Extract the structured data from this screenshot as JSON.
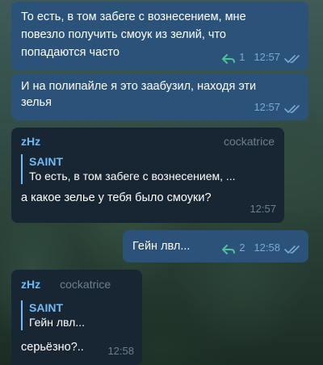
{
  "messages": [
    {
      "text": "То есть, в том забеге с вознесением, мне повезло получить смоук из зелий, что попадаются часто",
      "replies": "1",
      "time": "12:57"
    },
    {
      "text": "И на полипайле я это заабузил, находя эти зелья",
      "time": "12:57"
    },
    {
      "sender": "zHz",
      "tag": "cockatrice",
      "quote_author": "SAINT",
      "quote_text": "То есть, в том забеге с вознесением, ...",
      "text": "а какое зелье у тебя было смоуки?",
      "time": "12:57"
    },
    {
      "text": "Гейн лвл...",
      "replies": "2",
      "time": "12:58"
    },
    {
      "sender": "zHz",
      "tag": "cockatrice",
      "quote_author": "SAINT",
      "quote_text": "Гейн лвл...",
      "text": "серьёзно?..",
      "time": "12:58"
    }
  ],
  "colors": {
    "outgoing_bubble": "#2b5278",
    "incoming_bubble": "#182533",
    "accent": "#71baf5",
    "meta": "#7da8d3"
  }
}
